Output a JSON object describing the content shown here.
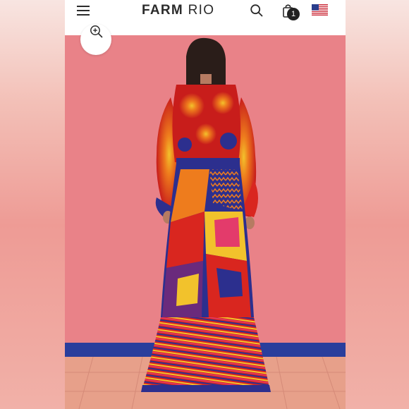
{
  "header": {
    "brand_bold": "FARM",
    "brand_light": "RIO",
    "cart_count": "1",
    "icons": [
      "menu-icon",
      "search-icon",
      "shopping-bag-icon",
      "us-flag-icon"
    ]
  },
  "product_image": {
    "zoom_icon": "zoom-in-icon"
  },
  "colors": {
    "wall": "#e98288",
    "wall_stripe": "#2a3e9c",
    "floor": "#e7a08a",
    "hair": "#2a1d19",
    "skin": "#b67b62",
    "dress_red": "#d9261f",
    "dress_orange": "#ee7c1d",
    "dress_yellow": "#f2c22c",
    "dress_navy": "#2c2f8e",
    "dress_purple": "#6a2a7c",
    "dress_pink": "#e33b6b"
  }
}
